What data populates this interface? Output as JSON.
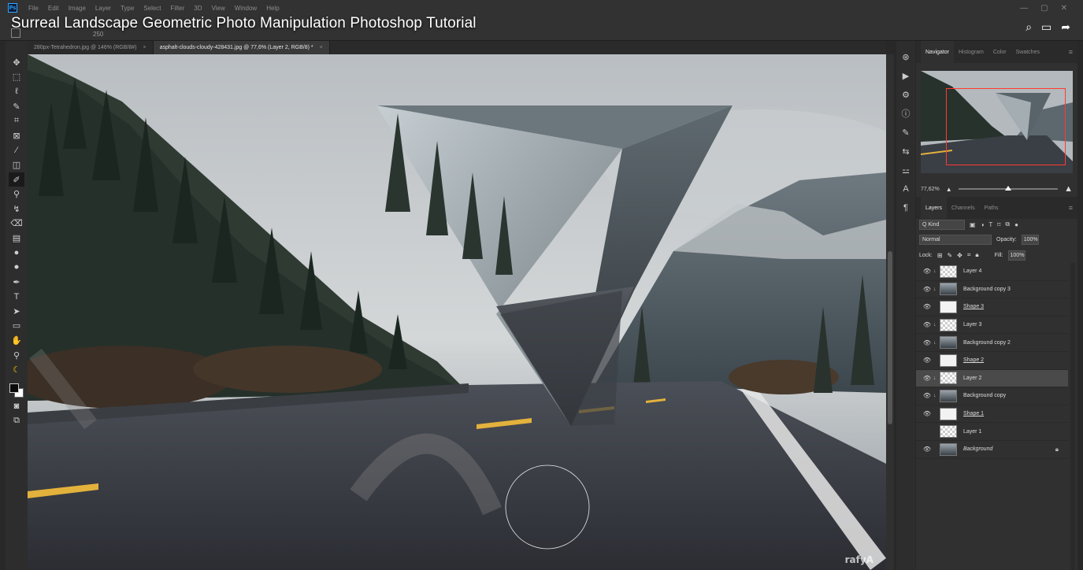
{
  "video": {
    "title": "Surreal Landscape Geometric Photo Manipulation Photoshop Tutorial",
    "watermark": "rafyA"
  },
  "menu": {
    "logo": "Ps",
    "items": [
      "File",
      "Edit",
      "Image",
      "Layer",
      "Type",
      "Select",
      "Filter",
      "3D",
      "View",
      "Window",
      "Help"
    ]
  },
  "options": {
    "brush_size": "250"
  },
  "tabs": [
    {
      "label": "280px-Tetrahedron.jpg @ 146% (RGB/8#)",
      "close": "×",
      "active": false
    },
    {
      "label": "asphalt-clouds-cloudy-428431.jpg @ 77,6% (Layer 2, RGB/8) *",
      "close": "×",
      "active": true
    }
  ],
  "navigator": {
    "tabs": [
      "Navigator",
      "Histogram",
      "Color",
      "Swatches"
    ],
    "zoom": "77,62%",
    "zoom_slider_fraction": 0.5
  },
  "layers_panel": {
    "tabs": [
      "Layers",
      "Channels",
      "Paths"
    ],
    "filter_kind": "Q Kind",
    "blend_mode": "Normal",
    "opacity_label": "Opacity:",
    "opacity": "100%",
    "lock_label": "Lock:",
    "fill_label": "Fill:",
    "fill": "100%",
    "layers": [
      {
        "name": "Layer 4",
        "visible": true,
        "clipped": true,
        "thumb": "trans",
        "selected": false,
        "style": ""
      },
      {
        "name": "Background copy 3",
        "visible": true,
        "clipped": true,
        "thumb": "photo",
        "selected": false,
        "style": ""
      },
      {
        "name": "Shape 3",
        "visible": true,
        "clipped": false,
        "thumb": "shape",
        "selected": false,
        "style": "underline"
      },
      {
        "name": "Layer 3",
        "visible": true,
        "clipped": true,
        "thumb": "trans",
        "selected": false,
        "style": ""
      },
      {
        "name": "Background copy 2",
        "visible": true,
        "clipped": true,
        "thumb": "photo",
        "selected": false,
        "style": ""
      },
      {
        "name": "Shape 2",
        "visible": true,
        "clipped": false,
        "thumb": "shape",
        "selected": false,
        "style": "underline"
      },
      {
        "name": "Layer 2",
        "visible": true,
        "clipped": true,
        "thumb": "trans",
        "selected": true,
        "style": ""
      },
      {
        "name": "Background copy",
        "visible": true,
        "clipped": true,
        "thumb": "photo",
        "selected": false,
        "style": ""
      },
      {
        "name": "Shape 1",
        "visible": true,
        "clipped": false,
        "thumb": "shape",
        "selected": false,
        "style": "underline"
      },
      {
        "name": "Layer 1",
        "visible": false,
        "clipped": false,
        "thumb": "trans",
        "selected": false,
        "style": ""
      },
      {
        "name": "Background",
        "visible": true,
        "clipped": false,
        "thumb": "photo",
        "selected": false,
        "style": "italic",
        "locked": true
      }
    ]
  },
  "colors": {
    "accent_frame": "#ff3b30",
    "road_line": "#e3b23c",
    "selected_row": "#4a4a4a"
  }
}
